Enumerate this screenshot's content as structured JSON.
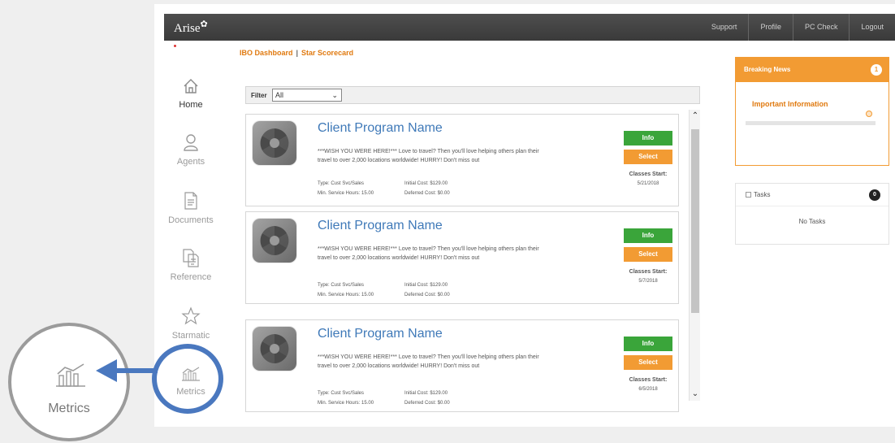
{
  "app": {
    "logo": "Arise",
    "top_nav": [
      "Support",
      "Profile",
      "PC Check",
      "Logout"
    ]
  },
  "sidebar": {
    "items": [
      {
        "label": "Home",
        "icon": "home-icon",
        "active": true
      },
      {
        "label": "Agents",
        "icon": "agent-icon",
        "active": false
      },
      {
        "label": "Documents",
        "icon": "document-icon",
        "active": false
      },
      {
        "label": "Reference",
        "icon": "reference-icon",
        "active": false
      },
      {
        "label": "Starmatic",
        "icon": "star-icon",
        "active": false
      },
      {
        "label": "Metrics",
        "icon": "metrics-chart-icon",
        "active": false
      }
    ]
  },
  "breadcrumb": {
    "items": [
      "IBO Dashboard",
      "Star Scorecard"
    ],
    "separator": "|"
  },
  "filter": {
    "label": "Filter",
    "selected": "All"
  },
  "programs": [
    {
      "title": "Client Program Name",
      "description": "***WISH YOU WERE HERE!*** Love to travel? Then you'll love helping others plan their travel to over 2,000 locations worldwide! HURRY! Don't miss out",
      "type": "Type: Cust Svc/Sales",
      "min_hours": "Min. Service Hours: 15.00",
      "initial_cost": "Initial Cost: $129.00",
      "deferred_cost": "Deferred Cost: $0.00",
      "info_label": "Info",
      "select_label": "Select",
      "classes_start_label": "Classes Start:",
      "classes_start_date": "5/21/2018"
    },
    {
      "title": "Client Program Name",
      "description": "***WISH YOU WERE HERE!*** Love to travel? Then you'll love helping others plan their travel to over 2,000 locations worldwide! HURRY! Don't miss out",
      "type": "Type: Cust Svc/Sales",
      "min_hours": "Min. Service Hours: 15.00",
      "initial_cost": "Initial Cost: $129.00",
      "deferred_cost": "Deferred Cost: $0.00",
      "info_label": "Info",
      "select_label": "Select",
      "classes_start_label": "Classes Start:",
      "classes_start_date": "5/7/2018"
    },
    {
      "title": "Client Program Name",
      "description": "***WISH YOU WERE HERE!*** Love to travel? Then you'll love helping others plan their travel to over 2,000 locations worldwide! HURRY! Don't miss out",
      "type": "Type: Cust Svc/Sales",
      "min_hours": "Min. Service Hours: 15.00",
      "initial_cost": "Initial Cost: $129.00",
      "deferred_cost": "Deferred Cost: $0.00",
      "info_label": "Info",
      "select_label": "Select",
      "classes_start_label": "Classes Start:",
      "classes_start_date": "6/5/2018"
    }
  ],
  "breaking_news": {
    "title": "Breaking News",
    "count": "1",
    "item": "Important Information"
  },
  "tasks": {
    "title": "Tasks",
    "count": "0",
    "empty_text": "No Tasks"
  },
  "callout": {
    "label": "Metrics",
    "icon": "metrics-chart-icon"
  },
  "colors": {
    "accent_orange": "#f29b33",
    "info_green": "#3aa53a",
    "title_blue": "#3f79b8",
    "callout_blue": "#4a78bf",
    "topbar": "#444444"
  }
}
